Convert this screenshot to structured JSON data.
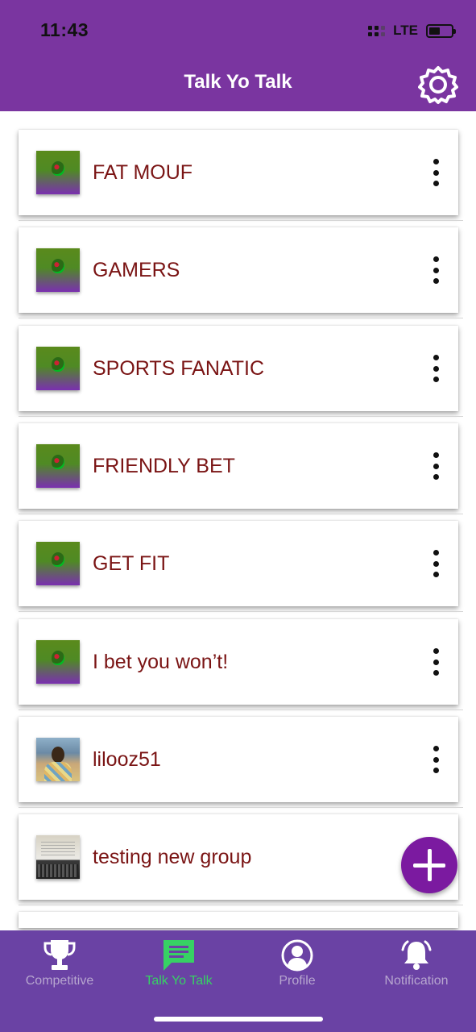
{
  "status_bar": {
    "time": "11:43",
    "network": "LTE",
    "battery_level": 0.5
  },
  "header": {
    "title": "Talk Yo Talk",
    "settings_icon": "gear-icon"
  },
  "conversations": [
    {
      "name": "FAT MOUF",
      "avatar": "group-avatar"
    },
    {
      "name": "GAMERS",
      "avatar": "group-avatar"
    },
    {
      "name": "SPORTS FANATIC",
      "avatar": "group-avatar"
    },
    {
      "name": "FRIENDLY BET",
      "avatar": "group-avatar"
    },
    {
      "name": "GET FIT",
      "avatar": "group-avatar"
    },
    {
      "name": "I bet you won’t!",
      "avatar": "group-avatar"
    },
    {
      "name": "lilooz51",
      "avatar": "user-photo"
    },
    {
      "name": "testing new group",
      "avatar": "group-photo"
    }
  ],
  "fab": {
    "icon": "plus-icon"
  },
  "tabs": [
    {
      "label": "Competitive",
      "icon": "trophy-icon",
      "active": false
    },
    {
      "label": "Talk Yo Talk",
      "icon": "chat-icon",
      "active": true
    },
    {
      "label": "Profile",
      "icon": "user-icon",
      "active": false
    },
    {
      "label": "Notification",
      "icon": "bell-icon",
      "active": false
    }
  ],
  "colors": {
    "header": "#7a35a0",
    "tab_bar": "#6a42a4",
    "tab_active": "#37d164",
    "tab_inactive": "#b7a6cf",
    "item_text": "#7a1414",
    "fab": "#7b1aa0"
  }
}
